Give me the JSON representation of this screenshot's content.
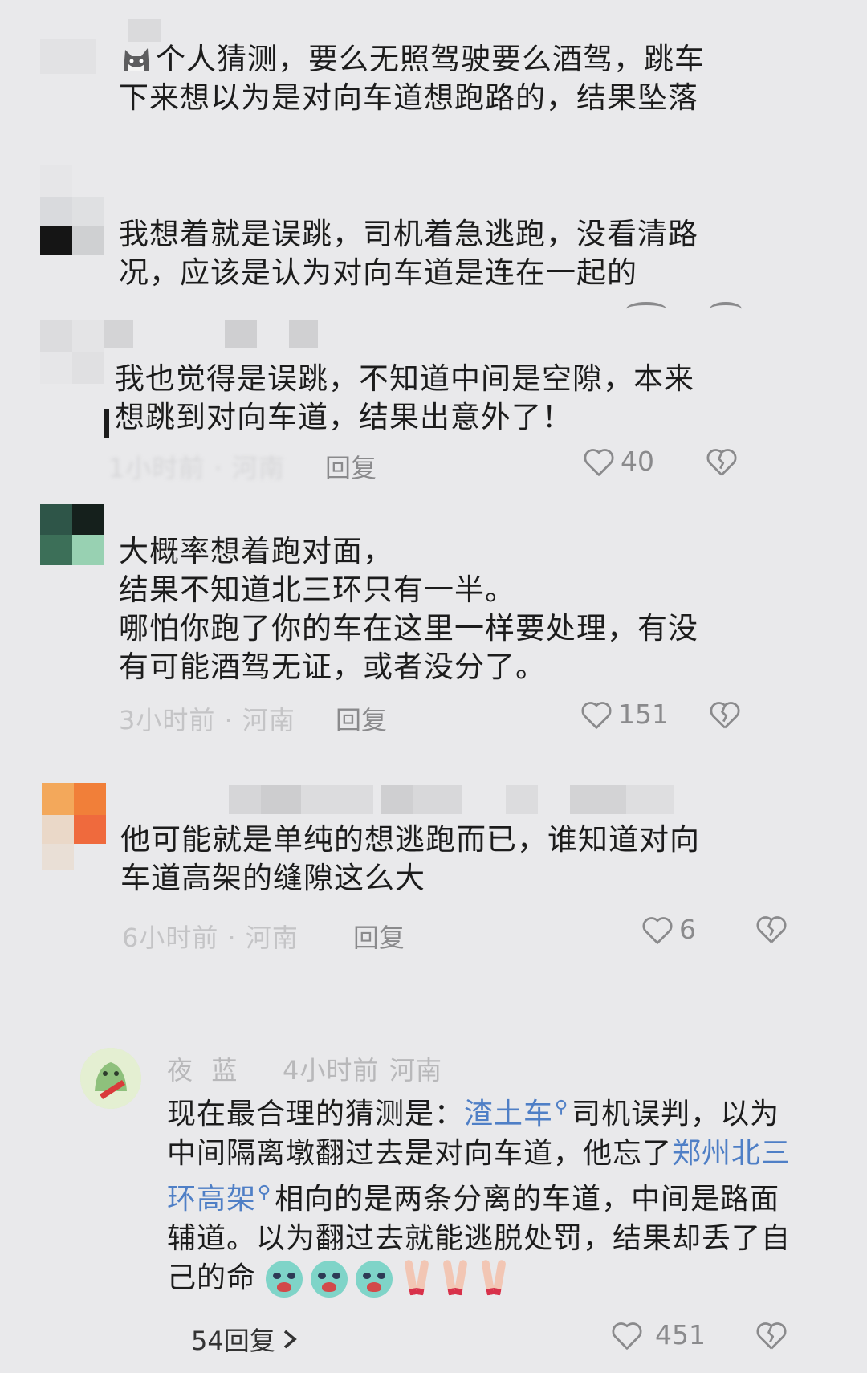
{
  "comments": [
    {
      "text": "个人猜测，要么无照驾驶要么酒驾，跳车\n下来想以为是对向车道想跑路的，结果坠落"
    },
    {
      "text": "我想着就是误跳，司机着急逃跑，没看清路\n况，应该是认为对向车道是连在一起的"
    },
    {
      "text": "我也觉得是误跳，不知道中间是空隙，本来\n想跳到对向车道，结果出意外了！",
      "meta": "1小时前 · 河南",
      "reply": "回复",
      "likes": "40"
    },
    {
      "text": "大概率想着跑对面，\n结果不知道北三环只有一半。\n哪怕你跑了你的车在这里一样要处理，有没\n有可能酒驾无证，或者没分了。",
      "meta": "3小时前 · 河南",
      "reply": "回复",
      "likes": "151"
    },
    {
      "text": "他可能就是单纯的想逃跑而已，谁知道对向\n车道高架的缝隙这么大",
      "meta": "6小时前 · 河南",
      "reply": "回复",
      "likes": "6"
    }
  ],
  "featured": {
    "author": "夜  蓝",
    "time": "4小时前",
    "location": "河南",
    "text_part1": "现在最合理的猜测是：",
    "link1": "渣土车",
    "text_part2": "司机误判，以为\n中间隔离墩翻过去是对向车道，他忘了",
    "link2a": "郑州北三",
    "link2b": "环高架",
    "text_part3": "相向的是两条分离的车道，中间是路面\n辅道。以为翻过去就能逃脱处罚，结果却丢了自\n己的命",
    "replies": "54回复",
    "likes": "451"
  },
  "icons": {
    "like": "heart-outline-icon",
    "dislike": "broken-heart-icon",
    "search": "search-icon",
    "chevron": "chevron-right-icon"
  },
  "colors": {
    "background": "#e9e9eb",
    "text": "#1c1c1c",
    "link": "#4f7fc6",
    "muted": "#8a8a8c"
  }
}
